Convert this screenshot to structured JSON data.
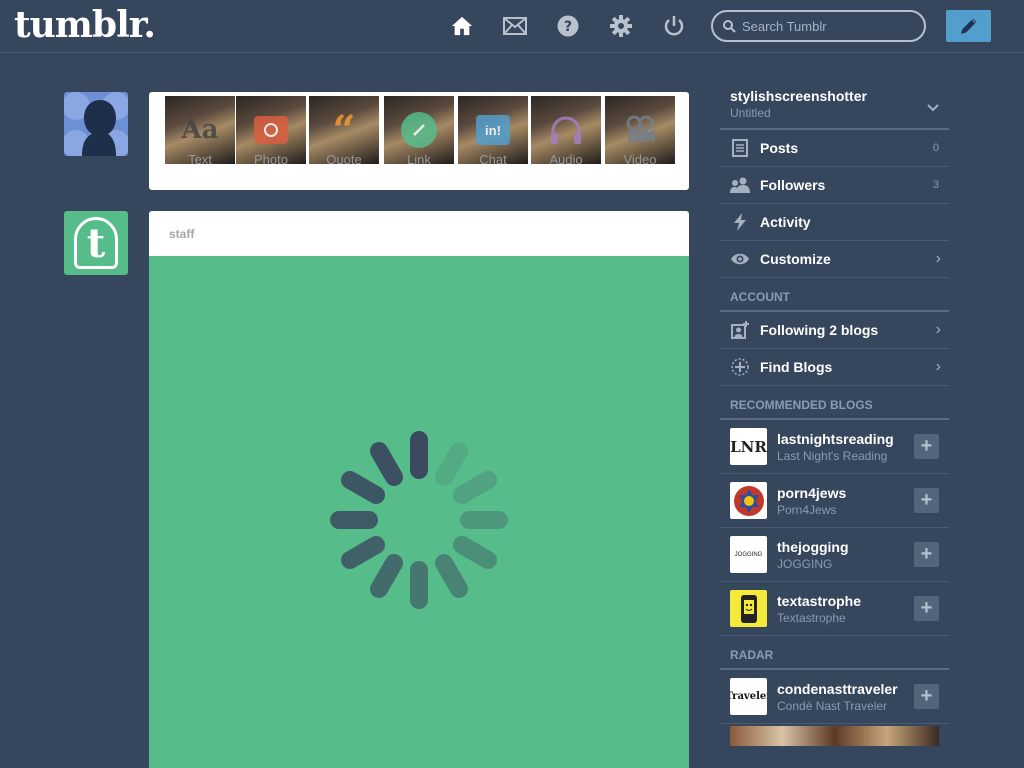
{
  "header": {
    "logo": "tumblr.",
    "search_placeholder": "Search Tumblr",
    "nav_icons": [
      "home-icon",
      "mail-icon",
      "help-icon",
      "settings-icon",
      "power-icon"
    ],
    "compose_icon": "pencil-icon"
  },
  "post_types": [
    "Text",
    "Photo",
    "Quote",
    "Link",
    "Chat",
    "Audio",
    "Video"
  ],
  "post_type_colors": [
    "#444444",
    "#d95e40",
    "#f2992e",
    "#56bc8a",
    "#529ecc",
    "#a77dc2",
    "#748089"
  ],
  "feed": {
    "post_blog": "staff",
    "post_bg_color": "#56bc8a"
  },
  "sidebar": {
    "blog_name": "stylishscreenshotter",
    "blog_title": "Untitled",
    "items": [
      {
        "label": "Posts",
        "count": "0"
      },
      {
        "label": "Followers",
        "count": "3"
      },
      {
        "label": "Activity",
        "count": ""
      },
      {
        "label": "Customize",
        "count": ""
      }
    ],
    "account_header": "ACCOUNT",
    "account_items": [
      {
        "label": "Following 2 blogs"
      },
      {
        "label": "Find Blogs"
      }
    ],
    "recommended_header": "RECOMMENDED BLOGS",
    "recommended": [
      {
        "name": "lastnightsreading",
        "title": "Last Night's Reading",
        "thumb_text": "LNR"
      },
      {
        "name": "porn4jews",
        "title": "Porn4Jews",
        "thumb_text": ""
      },
      {
        "name": "thejogging",
        "title": "JOGGING",
        "thumb_text": "JOGGING"
      },
      {
        "name": "textastrophe",
        "title": "Textastrophe",
        "thumb_text": ""
      }
    ],
    "radar_header": "RADAR",
    "radar": [
      {
        "name": "condenasttraveler",
        "title": "Condé Nast Traveler",
        "thumb_text": "Traveler"
      }
    ]
  },
  "colors": {
    "background": "#36465d",
    "compose_button": "#529ecc",
    "staff_avatar": "#56bc8a"
  }
}
